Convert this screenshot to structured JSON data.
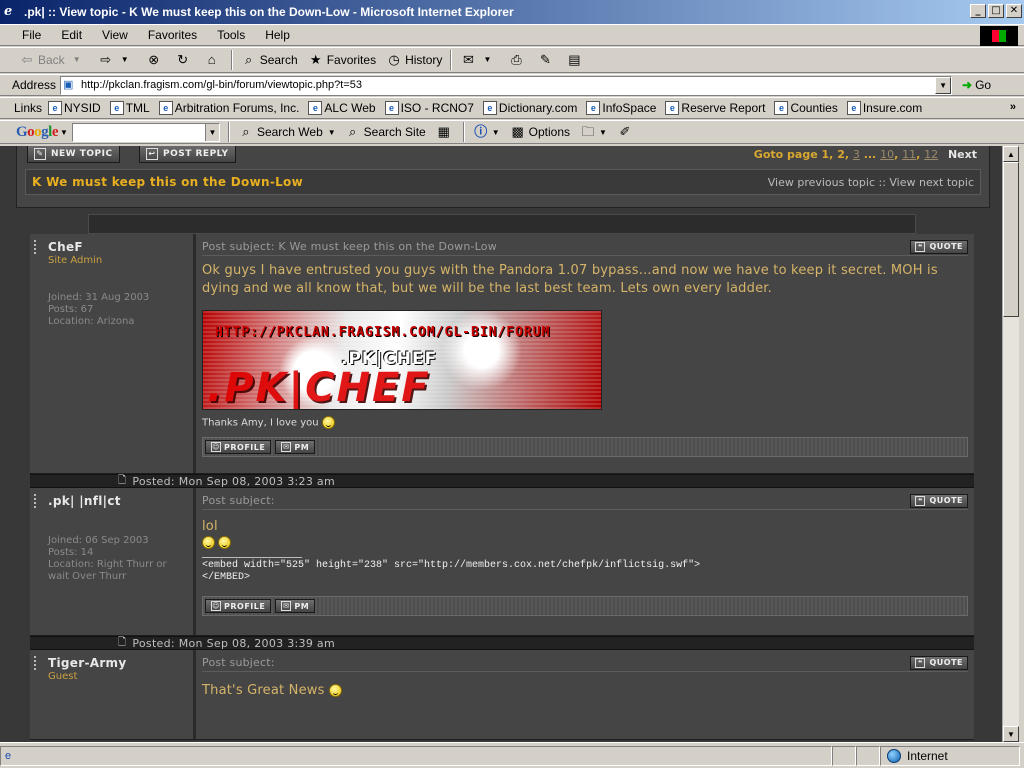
{
  "window": {
    "title": ".pk| :: View topic - K We must keep this on the Down-Low - Microsoft Internet Explorer",
    "min": "_",
    "max": "□",
    "close": "✕"
  },
  "menu": [
    "File",
    "Edit",
    "View",
    "Favorites",
    "Tools",
    "Help"
  ],
  "toolbar": {
    "back": "Back",
    "search": "Search",
    "favorites": "Favorites",
    "history": "History"
  },
  "address": {
    "label": "Address",
    "url": "http://pkclan.fragism.com/gl-bin/forum/viewtopic.php?t=53",
    "go": "Go"
  },
  "links": {
    "label": "Links",
    "items": [
      "NYSID",
      "TML",
      "Arbitration Forums, Inc.",
      "ALC Web",
      "ISO - RCNO7",
      "Dictionary.com",
      "InfoSpace",
      "Reserve Report",
      "Counties",
      "Insure.com"
    ]
  },
  "google": {
    "search_web": "Search Web",
    "search_site": "Search Site",
    "options": "Options"
  },
  "forum": {
    "new_topic": "New Topic",
    "post_reply": "Post Reply",
    "goto_label": "Goto page",
    "pages": [
      "1",
      "2",
      "3",
      "...",
      "10",
      "11",
      "12"
    ],
    "next": "Next",
    "topic_title": "K We must keep this on the Down-Low",
    "topic_nav": "View previous topic :: View next topic"
  },
  "posts": [
    {
      "author": "ChеF",
      "rank": "Site Admin",
      "joined": "Joined: 31 Aug 2003",
      "posts": "Posts: 67",
      "location": "Location: Arizona",
      "subject": "Post subject: K We must keep this on the Down-Low",
      "message": "Ok guys I have entrusted you guys with the Pandora 1.07 bypass...and now we have to keep it secret. MOH is dying and we all know that, but we will be the last best team. Lets own every ladder.",
      "sig_url": "HTTP://PKCLAN.FRAGISM.COM/GL-BIN/FORUM",
      "sig_tag": ".PK|CHEF",
      "sig_big": ".PK|CHEF",
      "footer_text": "Thanks Amy, I love you",
      "posted": "Posted: Mon Sep 08, 2003 3:23 am"
    },
    {
      "author": ".pk| |nfl|ct",
      "joined": "Joined: 06 Sep 2003",
      "posts": "Posts: 14",
      "location": "Location: Right Thurr or wait Over Thurr",
      "subject": "Post subject:",
      "message": "lol",
      "embed1": "<embed width=\"525\" height=\"238\" src=\"http://members.cox.net/chefpk/inflictsig.swf\">",
      "embed2": "</EMBED>",
      "posted": "Posted: Mon Sep 08, 2003 3:39 am"
    },
    {
      "author": "Tiger-Army",
      "rank": "Guest",
      "subject": "Post subject:",
      "message": "That's Great News"
    }
  ],
  "buttons": {
    "quote": "QUOTE",
    "profile": "PROFILE",
    "pm": "PM"
  },
  "status": {
    "zone": "Internet"
  },
  "colors": {
    "forum_bg": "#454545",
    "accent_gold": "#e8b020",
    "message_text": "#d6b468"
  }
}
